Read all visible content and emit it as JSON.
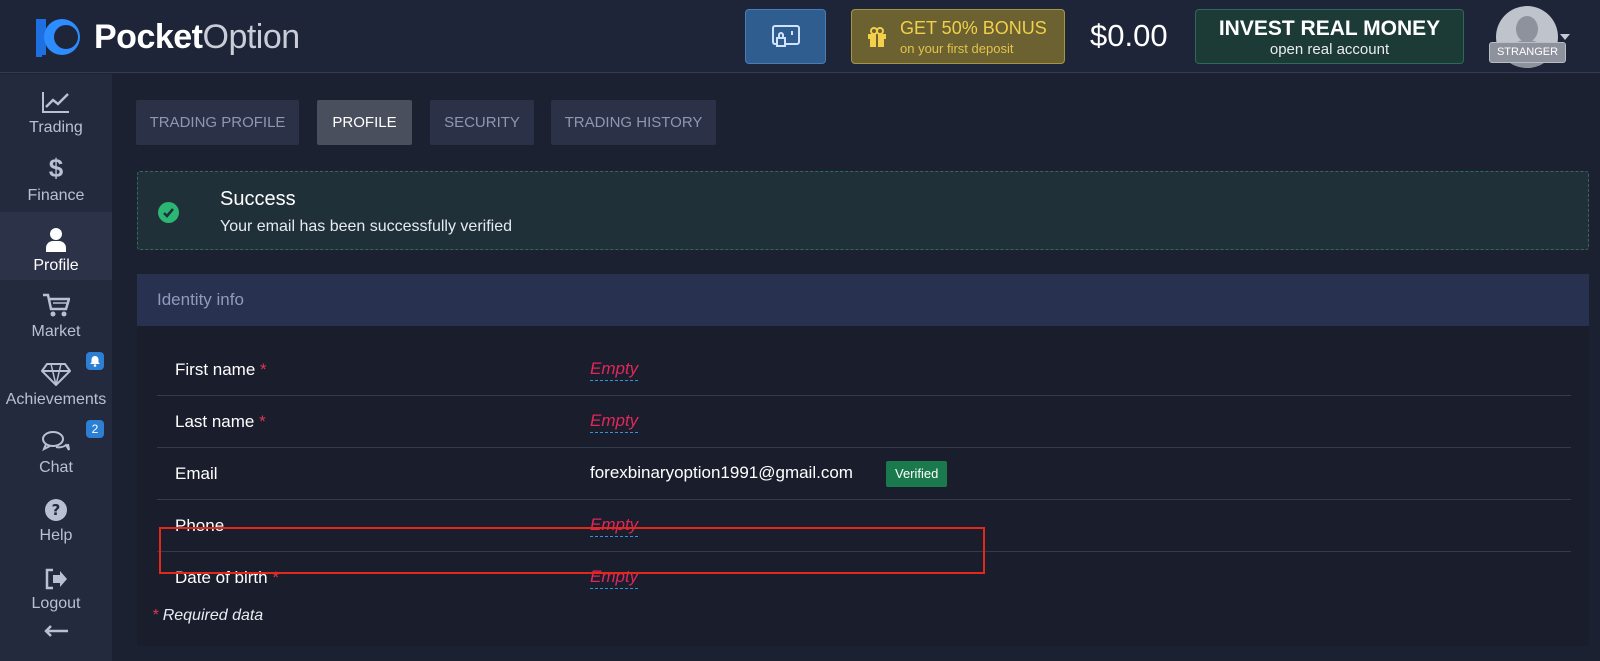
{
  "header": {
    "logo_bold": "Pocket",
    "logo_light": "Option",
    "bonus_title": "GET 50% BONUS",
    "bonus_subtitle": "on your first deposit",
    "balance": "$0.00",
    "invest_title": "INVEST REAL MONEY",
    "invest_subtitle": "open real account",
    "user_badge": "STRANGER"
  },
  "sidebar": {
    "items": [
      {
        "label": "Trading",
        "icon": "chart-line-icon"
      },
      {
        "label": "Finance",
        "icon": "dollar-icon"
      },
      {
        "label": "Profile",
        "icon": "user-icon",
        "active": true
      },
      {
        "label": "Market",
        "icon": "cart-icon"
      },
      {
        "label": "Achievements",
        "icon": "diamond-icon",
        "badge_icon": "bell-icon"
      },
      {
        "label": "Chat",
        "icon": "chat-icon",
        "badge": "2"
      },
      {
        "label": "Help",
        "icon": "question-icon"
      },
      {
        "label": "Logout",
        "icon": "logout-icon"
      }
    ]
  },
  "tabs": [
    {
      "label": "TRADING PROFILE"
    },
    {
      "label": "PROFILE",
      "active": true
    },
    {
      "label": "SECURITY"
    },
    {
      "label": "TRADING HISTORY"
    }
  ],
  "alert": {
    "title": "Success",
    "message": "Your email has been successfully verified"
  },
  "identity": {
    "heading": "Identity info",
    "first_name_label": "First name",
    "last_name_label": "Last name",
    "email_label": "Email",
    "phone_label": "Phone",
    "dob_label": "Date of birth",
    "required_star": "*",
    "empty_text": "Empty",
    "email_value": "forexbinaryoption1991@gmail.com",
    "verified_badge": "Verified",
    "required_note": "Required data"
  },
  "colors": {
    "accent_blue": "#2c7fd3",
    "success_green": "#2bb673",
    "required_red": "#e0364f",
    "highlight_red": "#e2271b"
  }
}
